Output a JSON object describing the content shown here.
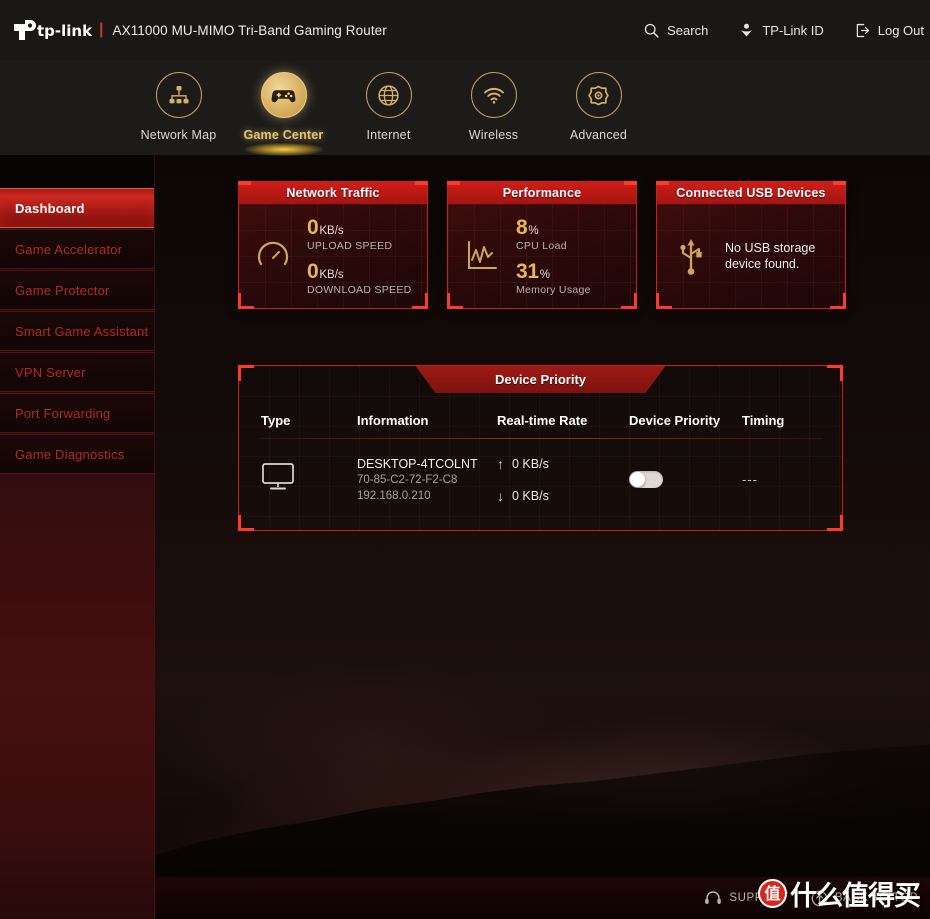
{
  "header": {
    "brand": "tp-link",
    "separator": "|",
    "model": "AX11000 MU-MIMO Tri-Band Gaming Router",
    "actions": [
      {
        "label": "Search",
        "icon": "search-icon"
      },
      {
        "label": "TP-Link ID",
        "icon": "tplink-id-icon"
      },
      {
        "label": "Log Out",
        "icon": "logout-icon"
      }
    ]
  },
  "nav": {
    "tabs": [
      {
        "label": "Network Map",
        "icon": "network-map-icon",
        "active": false
      },
      {
        "label": "Game Center",
        "icon": "gamepad-icon",
        "active": true
      },
      {
        "label": "Internet",
        "icon": "globe-icon",
        "active": false
      },
      {
        "label": "Wireless",
        "icon": "wifi-icon",
        "active": false
      },
      {
        "label": "Advanced",
        "icon": "gear-icon",
        "active": false
      }
    ]
  },
  "sidebar": {
    "items": [
      {
        "label": "Dashboard",
        "active": true
      },
      {
        "label": "Game Accelerator",
        "active": false
      },
      {
        "label": "Game Protector",
        "active": false
      },
      {
        "label": "Smart Game Assistant",
        "active": false
      },
      {
        "label": "VPN Server",
        "active": false
      },
      {
        "label": "Port Forwarding",
        "active": false
      },
      {
        "label": "Game Diagnostics",
        "active": false
      }
    ]
  },
  "cards": {
    "network_traffic": {
      "title": "Network Traffic",
      "icon": "speedometer-icon",
      "upload_value": "0",
      "upload_unit": "KB/s",
      "upload_label": "UPLOAD SPEED",
      "download_value": "0",
      "download_unit": "KB/s",
      "download_label": "DOWNLOAD SPEED"
    },
    "performance": {
      "title": "Performance",
      "icon": "chart-line-icon",
      "cpu_value": "8",
      "cpu_unit": "%",
      "cpu_label": "CPU Load",
      "mem_value": "31",
      "mem_unit": "%",
      "mem_label": "Memory Usage"
    },
    "usb": {
      "title": "Connected USB Devices",
      "icon": "usb-icon",
      "message": "No USB storage device found."
    }
  },
  "device_priority": {
    "title": "Device Priority",
    "columns": [
      "Type",
      "Information",
      "Real-time Rate",
      "Device Priority",
      "Timing"
    ],
    "rows": [
      {
        "type_icon": "desktop-monitor-icon",
        "name": "DESKTOP-4TCOLNT",
        "mac": "70-85-C2-72-F2-C8",
        "ip": "192.168.0.210",
        "upload_rate": "0 KB/s",
        "download_rate": "0 KB/s",
        "up_arrow": "↑",
        "down_arrow": "↓",
        "priority_on": false,
        "timing": "---"
      }
    ]
  },
  "footer": {
    "support_label": "SUPPORT",
    "support_icon": "headset-icon",
    "back_to_top_label": "BACK TO TOP",
    "back_to_top_icon": "arrow-up-circle-icon"
  },
  "watermark": {
    "badge": "值",
    "text": "什么值得买"
  },
  "colors": {
    "accent_red": "#c7201a",
    "bright_red": "#ff3a2a",
    "gold": "#e8b84b",
    "sidebar_red": "#b12a22"
  }
}
